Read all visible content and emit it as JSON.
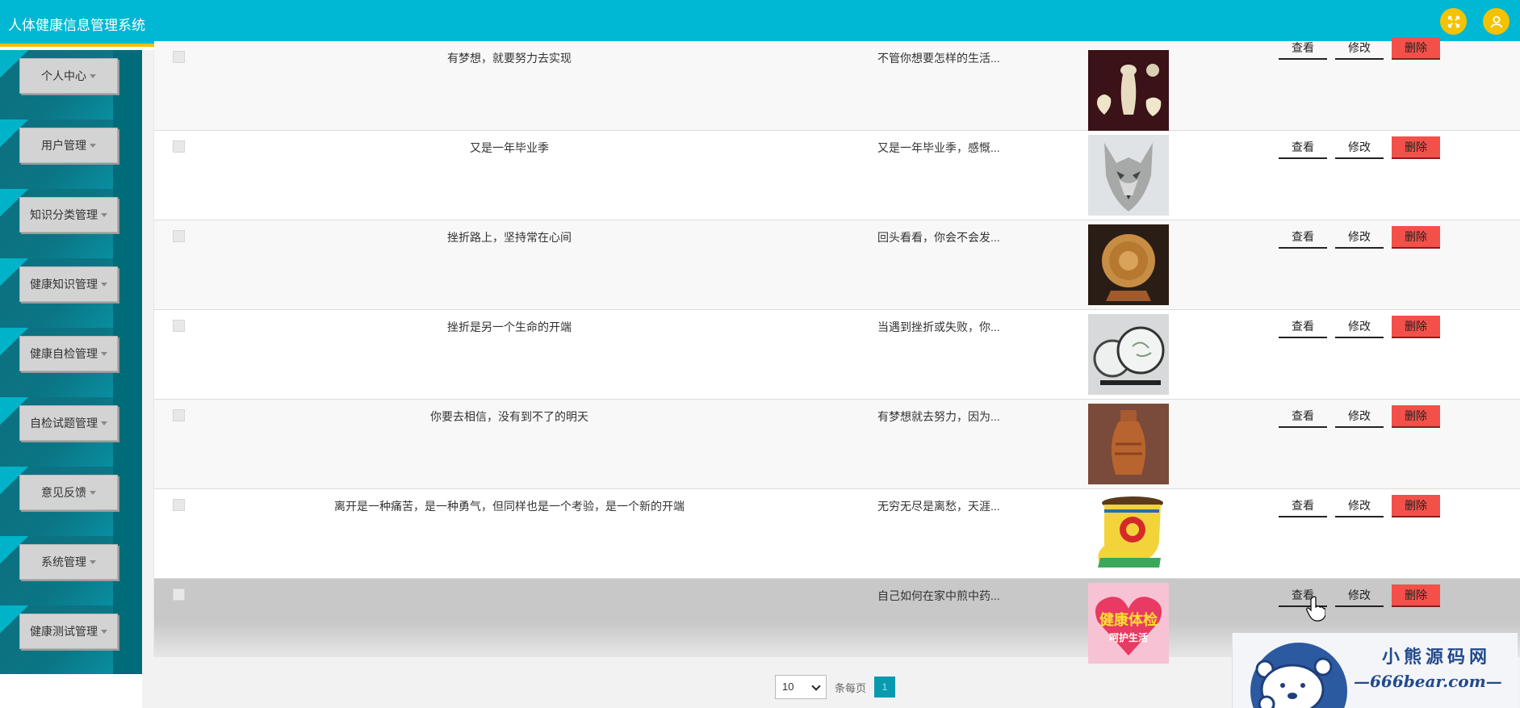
{
  "header": {
    "title": "人体健康信息管理系统",
    "fullscreen_icon": "expand-icon",
    "user_icon": "user-icon",
    "accent": "#00b8d3",
    "bar_color": "#f0c000"
  },
  "sidebar": {
    "items": [
      {
        "label": "个人中心"
      },
      {
        "label": "用户管理"
      },
      {
        "label": "知识分类管理"
      },
      {
        "label": "健康知识管理"
      },
      {
        "label": "健康自检管理"
      },
      {
        "label": "自检试题管理"
      },
      {
        "label": "意见反馈"
      },
      {
        "label": "系统管理"
      },
      {
        "label": "健康测试管理"
      }
    ]
  },
  "table": {
    "actions": {
      "view": "查看",
      "edit": "修改",
      "delete": "删除"
    },
    "rows": [
      {
        "title": "有梦想，就要努力去实现",
        "intro": "不管你想要怎样的生活...",
        "image": "ceramic-vases"
      },
      {
        "title": "又是一年毕业季",
        "intro": "又是一年毕业季，感慨...",
        "image": "wolf-head-sculpture"
      },
      {
        "title": "挫折路上，坚持常在心间",
        "intro": "回头看看，你会不会发...",
        "image": "carved-wood-disc"
      },
      {
        "title": "挫折是另一个生命的开端",
        "intro": "当遇到挫折或失败，你...",
        "image": "round-screen-ornament"
      },
      {
        "title": "你要去相信，没有到不了的明天",
        "intro": "有梦想就去努力，因为...",
        "image": "copper-vase"
      },
      {
        "title": "离开是一种痛苦，是一种勇气，但同样也是一个考验，是一个新的开端",
        "intro": "无穷无尽是离愁，天涯...",
        "image": "mongolian-boot-cup"
      },
      {
        "title": "",
        "intro": "自己如何在家中煎中药...",
        "image": "health-checkup-poster",
        "poster_text": "健康体检",
        "poster_sub": "呵护生活"
      }
    ]
  },
  "pagination": {
    "page_size": "10",
    "label": "条每页",
    "current_page": "1"
  },
  "watermark": {
    "name": "小熊源码网",
    "domain": "—666bear.com—"
  }
}
